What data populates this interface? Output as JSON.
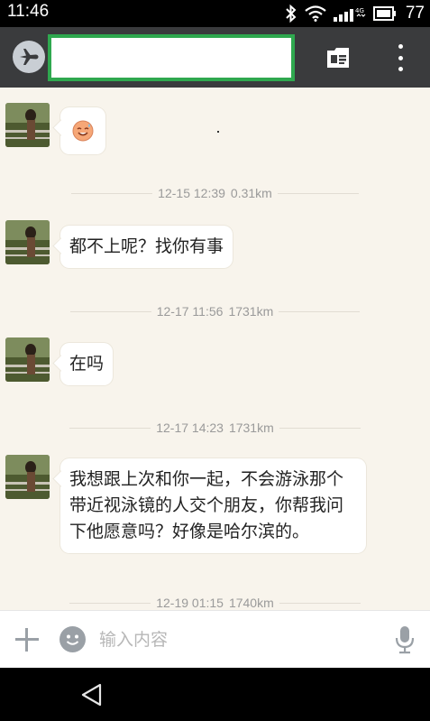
{
  "status_bar": {
    "time": "11:46",
    "battery": "77",
    "icons": [
      "bluetooth-icon",
      "wifi-icon",
      "signal-4g-icon",
      "battery-icon"
    ]
  },
  "app_bar": {
    "avatar_icon": "airplane-icon",
    "title": "",
    "profile_icon": "profile-card-icon",
    "more_icon": "more-vertical-icon"
  },
  "messages": [
    {
      "type": "emoji",
      "emoji": "😅"
    },
    {
      "type": "time",
      "time": "12-15 12:39",
      "distance": "0.31km"
    },
    {
      "type": "text",
      "text": "都不上呢？找你有事"
    },
    {
      "type": "time",
      "time": "12-17 11:56",
      "distance": "1731km"
    },
    {
      "type": "text",
      "text": "在吗"
    },
    {
      "type": "time",
      "time": "12-17 14:23",
      "distance": "1731km"
    },
    {
      "type": "text",
      "text": "我想跟上次和你一起，不会游泳那个带近视泳镜的人交个朋友，你帮我问下他愿意吗？好像是哈尔滨的。"
    },
    {
      "type": "time",
      "time": "12-19 01:15",
      "distance": "1740km"
    }
  ],
  "input_bar": {
    "placeholder": "输入内容",
    "value": "",
    "icons": [
      "plus-icon",
      "emoji-icon",
      "microphone-icon"
    ]
  },
  "nav_bar": {
    "back_icon": "back-triangle-icon"
  },
  "colors": {
    "status_bar": "#000000",
    "app_bar": "#3a3b3d",
    "title_highlight": "#2fa84f",
    "chat_background": "#f8f4ec",
    "bubble": "#ffffff",
    "timestamp": "#9a9a9a"
  }
}
